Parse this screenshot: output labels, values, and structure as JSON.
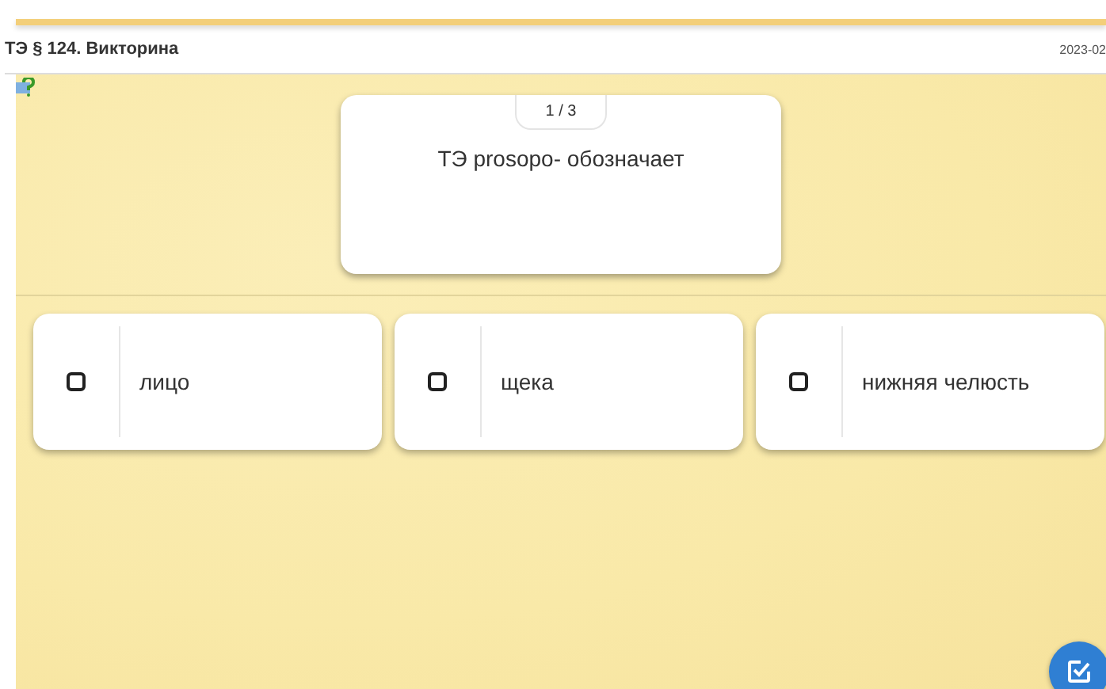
{
  "header": {
    "title": "ТЭ § 124. Викторина",
    "date": "2023-02"
  },
  "question": {
    "counter": "1 / 3",
    "text": "ТЭ prosopo- обозначает"
  },
  "options": [
    {
      "label": "лицо",
      "checked": false
    },
    {
      "label": "щека",
      "checked": false
    },
    {
      "label": "нижняя челюсть",
      "checked": false
    }
  ]
}
